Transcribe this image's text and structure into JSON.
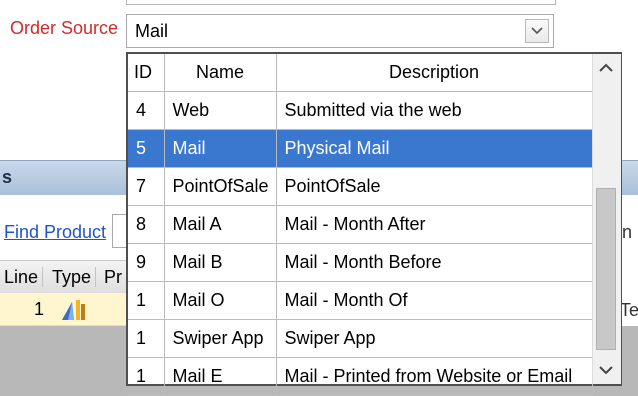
{
  "order_source": {
    "label": "Order Source",
    "selected_value": "Mail"
  },
  "background": {
    "section_title": "s",
    "find_product_link": "Find Product",
    "right_partial_1": "n",
    "right_partial_2": "Te",
    "columns": [
      "Line",
      "Type",
      "Pr"
    ],
    "row": {
      "line": "1"
    }
  },
  "dropdown": {
    "headers": {
      "id": "ID",
      "name": "Name",
      "description": "Description"
    },
    "rows": [
      {
        "id": "4",
        "name": "Web",
        "description": "Submitted via the web"
      },
      {
        "id": "5",
        "name": "Mail",
        "description": "Physical Mail",
        "selected": true
      },
      {
        "id": "7",
        "name": "PointOfSale",
        "description": "PointOfSale"
      },
      {
        "id": "8",
        "name": "Mail A",
        "description": "Mail - Month After"
      },
      {
        "id": "9",
        "name": "Mail B",
        "description": "Mail - Month Before"
      },
      {
        "id": "1",
        "name": "Mail O",
        "description": "Mail - Month Of"
      },
      {
        "id": "1",
        "name": "Swiper App",
        "description": "Swiper App"
      },
      {
        "id": "1",
        "name": "Mail E",
        "description": "Mail - Printed from Website or Email"
      }
    ]
  },
  "colors": {
    "label_red": "#d22a2a",
    "selection_blue": "#3a78d0",
    "link_blue": "#1f53c9"
  }
}
